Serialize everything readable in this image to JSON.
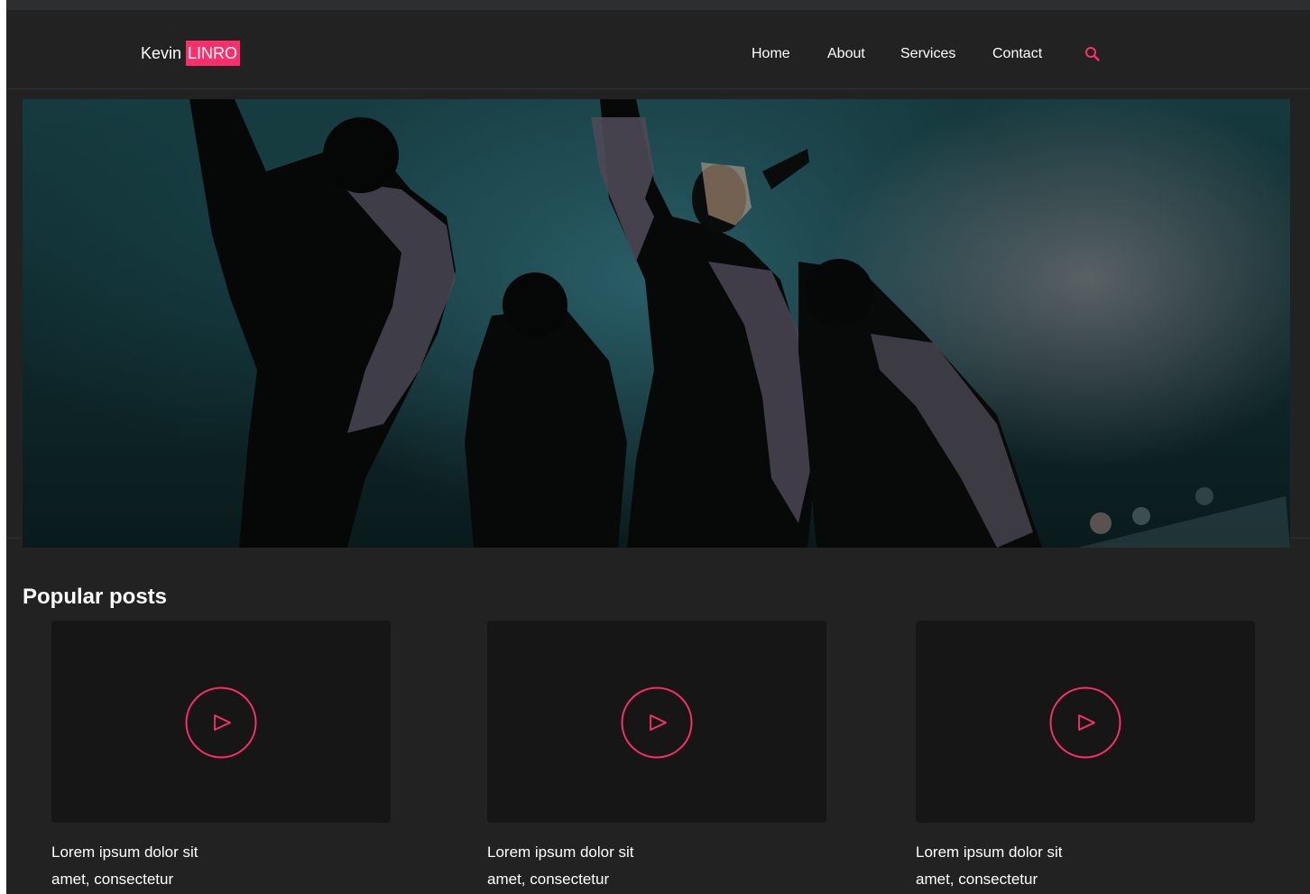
{
  "header": {
    "logo_first": "Kevin",
    "logo_highlight": "LINRO",
    "nav": [
      {
        "label": "Home"
      },
      {
        "label": "About"
      },
      {
        "label": "Services"
      },
      {
        "label": "Contact"
      }
    ],
    "search_icon": "search-icon"
  },
  "colors": {
    "accent": "#ff2d6a",
    "background": "#222223",
    "card": "#161617"
  },
  "main": {
    "section_title": "Popular posts",
    "posts": [
      {
        "title": "Lorem ipsum dolor sit amet, consectetur",
        "icon": "play-icon"
      },
      {
        "title": "Lorem ipsum dolor sit amet, consectetur",
        "icon": "play-icon"
      },
      {
        "title": "Lorem ipsum dolor sit amet, consectetur",
        "icon": "play-icon"
      }
    ]
  }
}
